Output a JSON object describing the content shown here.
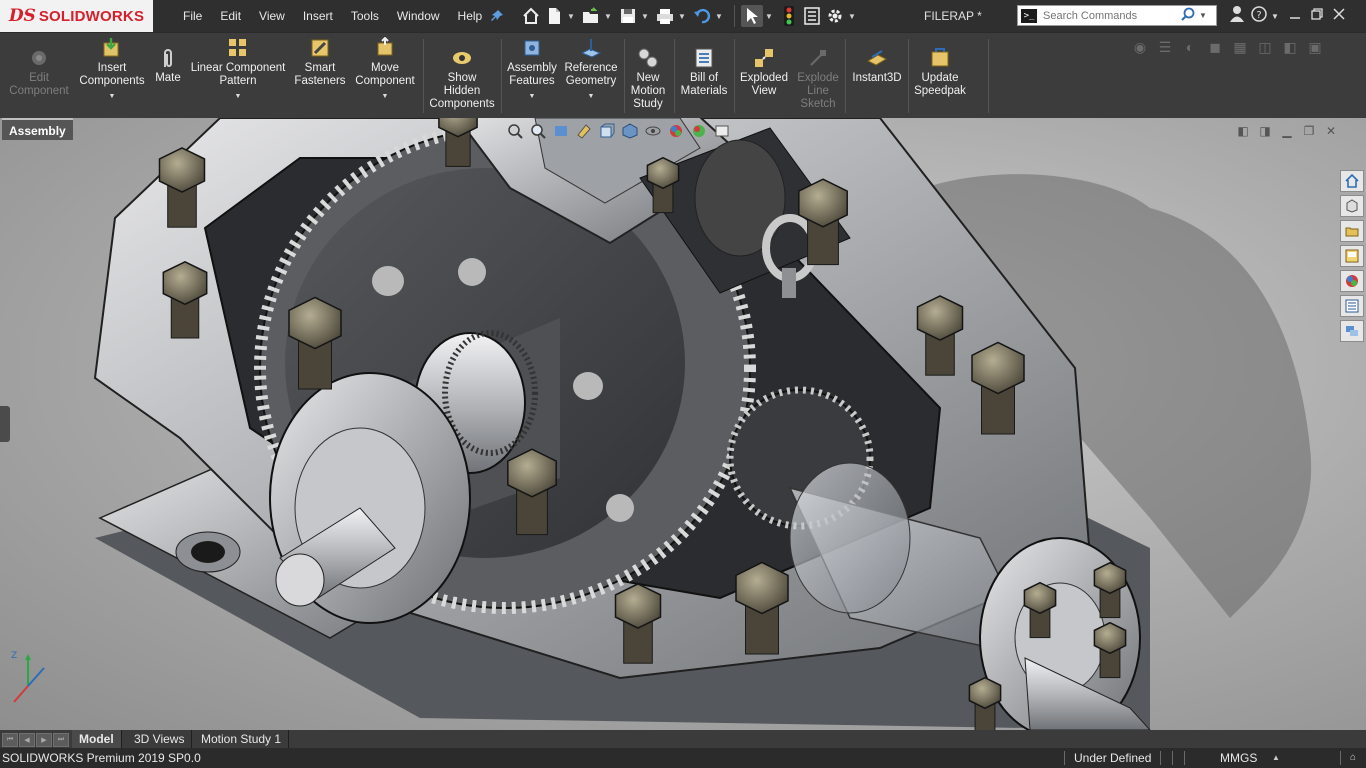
{
  "app": {
    "logo_mark": "DS",
    "logo_text": "SOLIDWORKS",
    "document_title": "FILERAP *"
  },
  "menus": [
    "File",
    "Edit",
    "View",
    "Insert",
    "Tools",
    "Window",
    "Help"
  ],
  "quick_access_icons": [
    "home-icon",
    "new-document-icon",
    "open-icon",
    "save-icon",
    "print-icon",
    "undo-icon",
    "select-icon",
    "rebuild-traffic-light-icon",
    "file-properties-icon",
    "options-gear-icon"
  ],
  "search": {
    "placeholder": "Search Commands"
  },
  "ribbon": {
    "edit_component": "Edit\nComponent",
    "insert_components": "Insert\nComponents",
    "mate": "Mate",
    "linear_pattern": "Linear Component\nPattern",
    "smart_fasteners": "Smart\nFasteners",
    "move_component": "Move\nComponent",
    "show_hidden": "Show\nHidden\nComponents",
    "assembly_features": "Assembly\nFeatures",
    "reference_geometry": "Reference\nGeometry",
    "new_motion_study": "New\nMotion\nStudy",
    "bill_of_materials": "Bill of\nMaterials",
    "exploded_view": "Exploded\nView",
    "explode_line_sketch": "Explode\nLine\nSketch",
    "instant3d": "Instant3D",
    "update_speedpak": "Update\nSpeedpak"
  },
  "command_tab": "Assembly",
  "bottom_tabs": [
    "Model",
    "3D Views",
    "Motion Study 1"
  ],
  "status": {
    "app_version": "SOLIDWORKS Premium 2019 SP0.0",
    "definition": "Under Defined",
    "units": "MMGS"
  },
  "colors": {
    "accent_red": "#d6202c",
    "ribbon_bg": "#3c3c3c",
    "titlebar_bg": "#2f2f2f",
    "statusbar_bg": "#2b2b2b"
  }
}
